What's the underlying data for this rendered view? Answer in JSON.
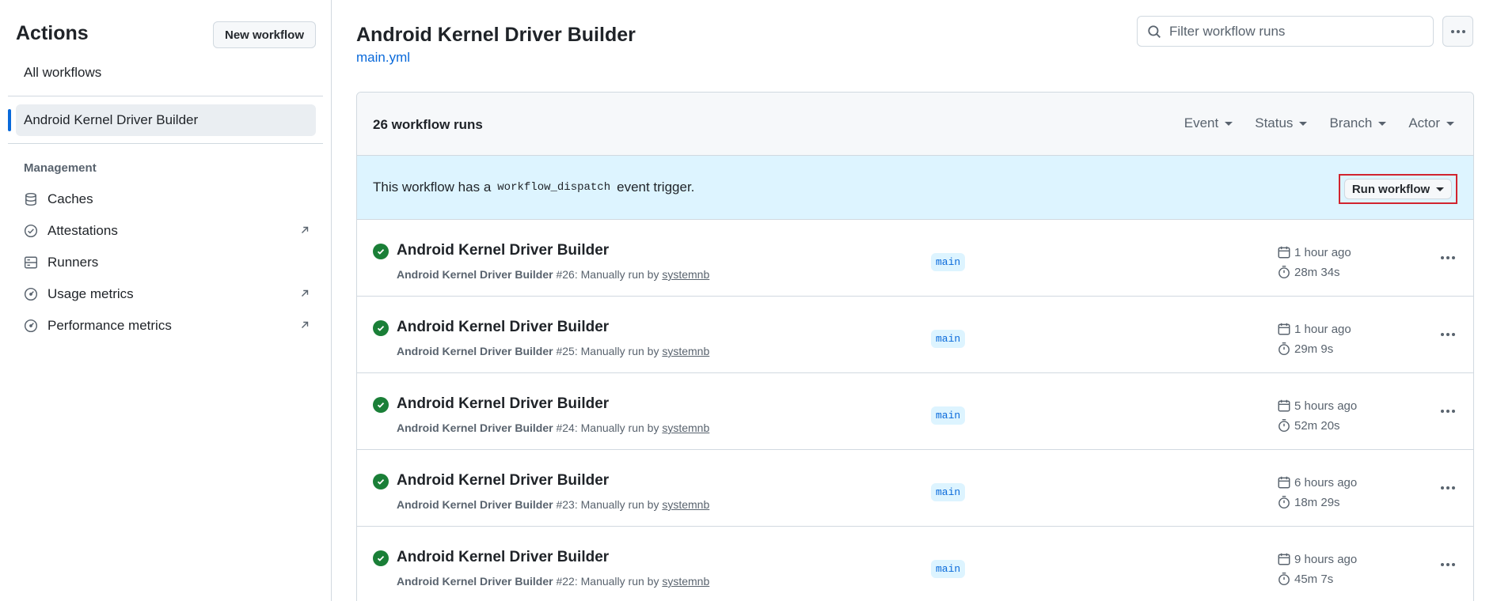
{
  "sidebar": {
    "title": "Actions",
    "new_workflow_label": "New workflow",
    "all_workflows_label": "All workflows",
    "active_workflow": "Android Kernel Driver Builder",
    "management_label": "Management",
    "items": [
      {
        "label": "Caches",
        "icon": "database-icon",
        "external": false
      },
      {
        "label": "Attestations",
        "icon": "verified-icon",
        "external": true
      },
      {
        "label": "Runners",
        "icon": "server-icon",
        "external": false
      },
      {
        "label": "Usage metrics",
        "icon": "meter-icon",
        "external": true
      },
      {
        "label": "Performance metrics",
        "icon": "meter-icon",
        "external": true
      }
    ]
  },
  "header": {
    "title": "Android Kernel Driver Builder",
    "file_link": "main.yml",
    "filter_placeholder": "Filter workflow runs"
  },
  "runs_panel": {
    "count_label": "26 workflow runs",
    "filters": [
      "Event",
      "Status",
      "Branch",
      "Actor"
    ]
  },
  "dispatch": {
    "text_before": "This workflow has a",
    "code": "workflow_dispatch",
    "text_after": "event trigger.",
    "run_button_label": "Run workflow"
  },
  "runs": [
    {
      "title": "Android Kernel Driver Builder",
      "workflow": "Android Kernel Driver Builder",
      "detail": "#26: Manually run by",
      "actor": "systemnb",
      "branch": "main",
      "when": "1 hour ago",
      "duration": "28m 34s",
      "status": "success"
    },
    {
      "title": "Android Kernel Driver Builder",
      "workflow": "Android Kernel Driver Builder",
      "detail": "#25: Manually run by",
      "actor": "systemnb",
      "branch": "main",
      "when": "1 hour ago",
      "duration": "29m 9s",
      "status": "success"
    },
    {
      "title": "Android Kernel Driver Builder",
      "workflow": "Android Kernel Driver Builder",
      "detail": "#24: Manually run by",
      "actor": "systemnb",
      "branch": "main",
      "when": "5 hours ago",
      "duration": "52m 20s",
      "status": "success"
    },
    {
      "title": "Android Kernel Driver Builder",
      "workflow": "Android Kernel Driver Builder",
      "detail": "#23: Manually run by",
      "actor": "systemnb",
      "branch": "main",
      "when": "6 hours ago",
      "duration": "18m 29s",
      "status": "success"
    },
    {
      "title": "Android Kernel Driver Builder",
      "workflow": "Android Kernel Driver Builder",
      "detail": "#22: Manually run by",
      "actor": "systemnb",
      "branch": "main",
      "when": "9 hours ago",
      "duration": "45m 7s",
      "status": "success"
    }
  ],
  "colors": {
    "accent": "#0969da",
    "success": "#1a7f37",
    "highlight_border": "#d1242f",
    "dispatch_bg": "#ddf4ff"
  }
}
